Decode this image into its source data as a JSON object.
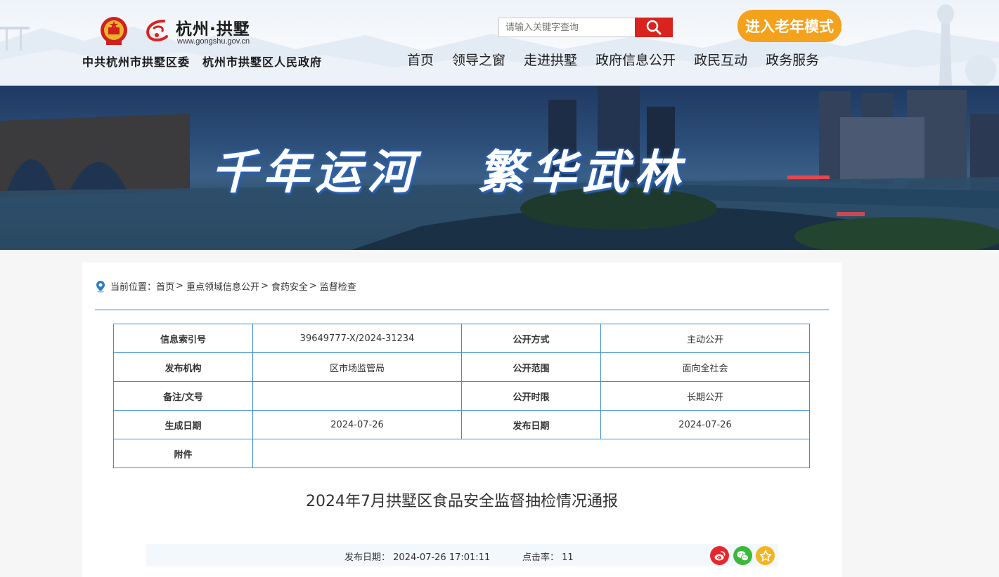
{
  "header": {
    "brand_name": "杭州·拱墅",
    "brand_url": "www.gongshu.gov.cn",
    "org_party": "中共杭州市拱墅区委",
    "org_gov": "杭州市拱墅区人民政府",
    "search_placeholder": "请输入关键字查询",
    "elder_mode_label": "进入老年模式",
    "nav": [
      "首页",
      "领导之窗",
      "走进拱墅",
      "政府信息公开",
      "政民互动",
      "政务服务"
    ]
  },
  "banner": {
    "slogan_left": "千年运河",
    "slogan_right": "繁华武林"
  },
  "breadcrumb": {
    "prefix": "当前位置：",
    "items": [
      "首页",
      "重点领域信息公开",
      "食药安全",
      "监督检查"
    ],
    "separator": ">"
  },
  "meta_table": {
    "rows": [
      {
        "k1": "信息索引号",
        "v1": "39649777-X/2024-31234",
        "k2": "公开方式",
        "v2": "主动公开"
      },
      {
        "k1": "发布机构",
        "v1": "区市场监管局",
        "k2": "公开范围",
        "v2": "面向全社会"
      },
      {
        "k1": "备注/文号",
        "v1": "",
        "k2": "公开时限",
        "v2": "长期公开"
      },
      {
        "k1": "生成日期",
        "v1": "2024-07-26",
        "k2": "发布日期",
        "v2": "2024-07-26"
      }
    ],
    "attachment_label": "附件",
    "attachment_value": ""
  },
  "article": {
    "title": "2024年7月拱墅区食品安全监督抽检情况通报",
    "publish_label": "发布日期：",
    "publish_value": "2024-07-26 17:01:11",
    "clicks_label": "点击率：",
    "clicks_value": "11"
  },
  "share_icons": [
    "weibo-icon",
    "wechat-icon",
    "favorite-icon"
  ],
  "colors": {
    "search_button": "#d9231e",
    "elder_button": "#f4a11c",
    "table_border": "#3a8fd3",
    "weibo": "#e6282c",
    "wechat": "#3db83a",
    "favorite": "#f3b51f"
  }
}
